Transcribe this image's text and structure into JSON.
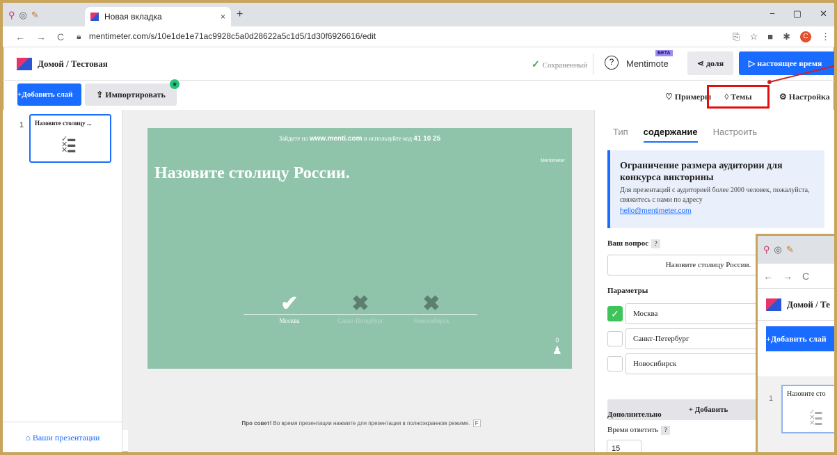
{
  "browser": {
    "tab_title": "Новая вкладка",
    "tab_close": "×",
    "new_tab": "+",
    "url": "mentimeter.com/s/10e1de1e71ac9928c5a0d28622a5c1d5/1d30f6926616/edit",
    "window_controls": [
      "−",
      "▢",
      "✕"
    ],
    "profile_initial": "C"
  },
  "header": {
    "breadcrumb": "Домой / Тестовая",
    "saved": "Сохраненный",
    "mentimote": "Mentimote",
    "beta": "БЕТА",
    "share": "доля",
    "present": "настоящее время"
  },
  "toolbar": {
    "add_slide": "+Добавить слай",
    "import": "Импортировать",
    "examples": "Примеры",
    "themes": "Темы",
    "settings": "Настройка"
  },
  "sidebar": {
    "slide_number": "1",
    "slide_title": "Назовите столицу ...",
    "your_presentations": "Ваши презентации"
  },
  "slide": {
    "join_prefix": "Зайдите на",
    "join_site": "www.menti.com",
    "join_mid": "и используйте код",
    "join_code": "41 10 25",
    "brand": "Mentimeter",
    "question": "Назовите столицу России.",
    "options": [
      {
        "label": "Москва",
        "correct": true
      },
      {
        "label": "Санкт-Петербург",
        "correct": false
      },
      {
        "label": "Новосибирск",
        "correct": false
      }
    ],
    "participants": "0"
  },
  "tip": {
    "bold": "Про совет!",
    "text": "Во время презентации нажмите для презентации в полноэкранном режиме.",
    "key": "F"
  },
  "panel": {
    "tabs": [
      "Тип",
      "содержание",
      "Настроить"
    ],
    "info_title": "Ограничение размера аудитории для конкурса викторины",
    "info_text": "Для презентаций с аудиторией более 2000 человек, пожалуйста, свяжитесь с нами по адресу",
    "info_email": "hello@mentimeter.com",
    "question_label": "Ваш вопрос",
    "question_value": "Назовите столицу России.",
    "params_label": "Параметры",
    "options": [
      "Москва",
      "Санкт-Петербург",
      "Новосибирск"
    ],
    "add_option": "+ Добавить",
    "extra_label": "Дополнительно",
    "time_label": "Время ответить",
    "time_value": "15",
    "help": "?"
  },
  "inset": {
    "breadcrumb": "Домой / Те",
    "add_slide": "+Добавить слай",
    "slide_number": "1",
    "slide_title": "Назовите сто"
  }
}
